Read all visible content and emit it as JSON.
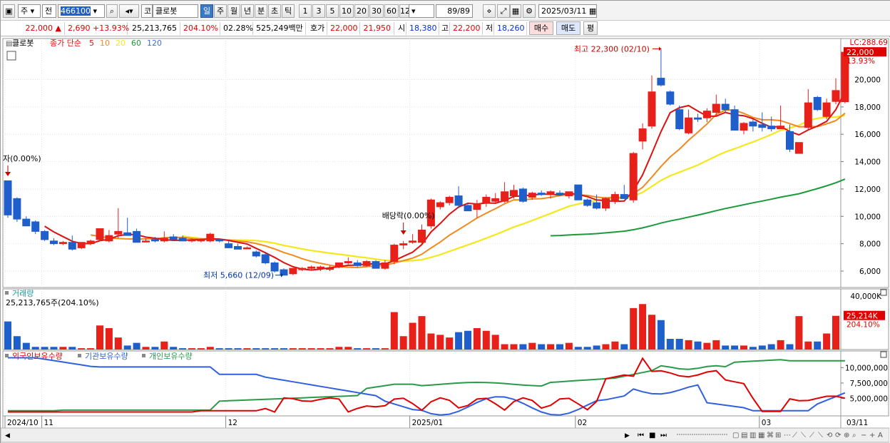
{
  "toolbar": {
    "chart_type": "주",
    "prev_label": "전",
    "code": "466100",
    "code_prefix": "코",
    "name": "클로봇",
    "periods": [
      "일",
      "주",
      "월",
      "년",
      "분",
      "초",
      "틱"
    ],
    "active_period": "일",
    "intervals": [
      "1",
      "3",
      "5",
      "10",
      "20",
      "30",
      "60",
      "120"
    ],
    "count": "89/89",
    "date": "2025/03/11"
  },
  "quote": {
    "price": "22,000",
    "up_arrow": "▲",
    "change": "2,690",
    "change_pct": "+13.93%",
    "volume": "25,213,765",
    "volume_ratio": "204.10%",
    "turnover": "02.28%",
    "amount": "525,249백만",
    "ask_label": "호가",
    "ask": "22,000",
    "bid": "21,950",
    "open_label": "시",
    "open": "18,380",
    "high_label": "고",
    "high": "22,200",
    "low_label": "저",
    "low": "18,260",
    "buy_label": "매수",
    "sell_label": "매도",
    "eval_label": "평"
  },
  "colors": {
    "up": "#e8201a",
    "down": "#1f5fcc",
    "ma5": "#dd1111",
    "ma10": "#f08a20",
    "ma20": "#f5e81a",
    "ma60": "#1a9a3a",
    "ma120": "#3a6fd8",
    "foreign": "#e00000",
    "institution": "#3060e0",
    "individual": "#2a9a4a"
  },
  "chart_data": {
    "type": "candlestick",
    "legend": {
      "name": "클로봇",
      "ma_label": "종가 단순",
      "periods": [
        "5",
        "10",
        "20",
        "60",
        "120"
      ]
    },
    "top_right_label": "LC:288.69",
    "price_axis": {
      "min": 4800,
      "max": 23000,
      "ticks": [
        6000,
        8000,
        10000,
        12000,
        14000,
        16000,
        18000,
        20000
      ],
      "tick_labels": [
        "6,000",
        "8,000",
        "10,000",
        "12,000",
        "14,000",
        "16,000",
        "18,000",
        "20,000"
      ]
    },
    "last_price_label": "22,000",
    "last_change_label": "13.93%",
    "annotations": {
      "high": "최고 22,300 (02/10)",
      "low": "최저 5,660 (12/09)",
      "listing": "자(0.00%)",
      "ex_dividend": "배당락(0.00%)"
    },
    "candles": [
      {
        "o": 12600,
        "h": 12600,
        "l": 9900,
        "c": 10100
      },
      {
        "o": 11300,
        "h": 11400,
        "l": 9600,
        "c": 9800
      },
      {
        "o": 9800,
        "h": 10000,
        "l": 9400,
        "c": 9300
      },
      {
        "o": 9600,
        "h": 9700,
        "l": 8700,
        "c": 8900
      },
      {
        "o": 8900,
        "h": 9000,
        "l": 8200,
        "c": 8300
      },
      {
        "o": 8200,
        "h": 8400,
        "l": 7900,
        "c": 8000
      },
      {
        "o": 8000,
        "h": 8200,
        "l": 7900,
        "c": 8100
      },
      {
        "o": 8100,
        "h": 8600,
        "l": 7500,
        "c": 7600
      },
      {
        "o": 7700,
        "h": 8100,
        "l": 7600,
        "c": 8100
      },
      {
        "o": 8000,
        "h": 8300,
        "l": 7900,
        "c": 8200
      },
      {
        "o": 8300,
        "h": 9000,
        "l": 8200,
        "c": 9100
      },
      {
        "o": 8200,
        "h": 9000,
        "l": 8100,
        "c": 8600
      },
      {
        "o": 8700,
        "h": 10600,
        "l": 8400,
        "c": 8900
      },
      {
        "o": 8800,
        "h": 9900,
        "l": 8700,
        "c": 8600
      },
      {
        "o": 8900,
        "h": 9100,
        "l": 8100,
        "c": 8100
      },
      {
        "o": 8200,
        "h": 8400,
        "l": 8100,
        "c": 8200
      },
      {
        "o": 8300,
        "h": 8500,
        "l": 8100,
        "c": 8200
      },
      {
        "o": 8200,
        "h": 8900,
        "l": 8100,
        "c": 8400
      },
      {
        "o": 8500,
        "h": 8700,
        "l": 8300,
        "c": 8300
      },
      {
        "o": 8400,
        "h": 8600,
        "l": 8200,
        "c": 8200
      },
      {
        "o": 8200,
        "h": 8400,
        "l": 8100,
        "c": 8300
      },
      {
        "o": 8200,
        "h": 8400,
        "l": 8100,
        "c": 8300
      },
      {
        "o": 8200,
        "h": 8800,
        "l": 8100,
        "c": 8700
      },
      {
        "o": 8300,
        "h": 8400,
        "l": 8100,
        "c": 8200
      },
      {
        "o": 8000,
        "h": 8200,
        "l": 7700,
        "c": 7700
      },
      {
        "o": 7800,
        "h": 8000,
        "l": 7600,
        "c": 7600
      },
      {
        "o": 7700,
        "h": 7800,
        "l": 7600,
        "c": 7700
      },
      {
        "o": 7400,
        "h": 7500,
        "l": 7000,
        "c": 7100
      },
      {
        "o": 7200,
        "h": 7400,
        "l": 6500,
        "c": 6600
      },
      {
        "o": 6600,
        "h": 6700,
        "l": 5900,
        "c": 6000
      },
      {
        "o": 6100,
        "h": 6200,
        "l": 5700,
        "c": 5700
      },
      {
        "o": 5800,
        "h": 6200,
        "l": 5700,
        "c": 6200
      },
      {
        "o": 6100,
        "h": 6300,
        "l": 6000,
        "c": 6200
      },
      {
        "o": 6200,
        "h": 6400,
        "l": 6100,
        "c": 6300
      },
      {
        "o": 6200,
        "h": 6400,
        "l": 6000,
        "c": 6300
      },
      {
        "o": 6200,
        "h": 6400,
        "l": 6000,
        "c": 6200
      },
      {
        "o": 6300,
        "h": 6600,
        "l": 6200,
        "c": 6600
      },
      {
        "o": 6600,
        "h": 7000,
        "l": 6500,
        "c": 6700
      },
      {
        "o": 6600,
        "h": 6800,
        "l": 6300,
        "c": 6400
      },
      {
        "o": 6400,
        "h": 6800,
        "l": 6300,
        "c": 6700
      },
      {
        "o": 6700,
        "h": 6800,
        "l": 6300,
        "c": 6200
      },
      {
        "o": 6200,
        "h": 6800,
        "l": 6100,
        "c": 6600
      },
      {
        "o": 6700,
        "h": 8000,
        "l": 6500,
        "c": 7900
      },
      {
        "o": 7900,
        "h": 8200,
        "l": 7600,
        "c": 8000
      },
      {
        "o": 8100,
        "h": 8700,
        "l": 8000,
        "c": 8200
      },
      {
        "o": 8100,
        "h": 9400,
        "l": 8000,
        "c": 9000
      },
      {
        "o": 9300,
        "h": 11300,
        "l": 9100,
        "c": 11200
      },
      {
        "o": 10700,
        "h": 11100,
        "l": 10500,
        "c": 11000
      },
      {
        "o": 11000,
        "h": 11500,
        "l": 10800,
        "c": 11400
      },
      {
        "o": 11500,
        "h": 12200,
        "l": 10600,
        "c": 10800
      },
      {
        "o": 10800,
        "h": 11000,
        "l": 10400,
        "c": 10400
      },
      {
        "o": 10500,
        "h": 11200,
        "l": 9900,
        "c": 10900
      },
      {
        "o": 11000,
        "h": 11600,
        "l": 10700,
        "c": 11400
      },
      {
        "o": 11100,
        "h": 11700,
        "l": 10900,
        "c": 11300
      },
      {
        "o": 11100,
        "h": 12500,
        "l": 11000,
        "c": 11800
      },
      {
        "o": 11500,
        "h": 12300,
        "l": 11300,
        "c": 11900
      },
      {
        "o": 12000,
        "h": 12100,
        "l": 11000,
        "c": 11100
      },
      {
        "o": 11400,
        "h": 11800,
        "l": 11200,
        "c": 11700
      },
      {
        "o": 11700,
        "h": 11900,
        "l": 11500,
        "c": 11600
      },
      {
        "o": 11600,
        "h": 11900,
        "l": 11300,
        "c": 11800
      },
      {
        "o": 11700,
        "h": 11900,
        "l": 11500,
        "c": 11600
      },
      {
        "o": 11500,
        "h": 11800,
        "l": 11300,
        "c": 11800
      },
      {
        "o": 12300,
        "h": 12300,
        "l": 11200,
        "c": 11200
      },
      {
        "o": 11200,
        "h": 11300,
        "l": 10700,
        "c": 10800
      },
      {
        "o": 11000,
        "h": 11600,
        "l": 10500,
        "c": 10600
      },
      {
        "o": 10600,
        "h": 11400,
        "l": 10400,
        "c": 11300
      },
      {
        "o": 11100,
        "h": 11800,
        "l": 10900,
        "c": 11600
      },
      {
        "o": 11600,
        "h": 12300,
        "l": 11300,
        "c": 11300
      },
      {
        "o": 11200,
        "h": 14700,
        "l": 11000,
        "c": 14600
      },
      {
        "o": 15500,
        "h": 16800,
        "l": 14900,
        "c": 16400
      },
      {
        "o": 16600,
        "h": 20300,
        "l": 16400,
        "c": 19100
      },
      {
        "o": 20100,
        "h": 22300,
        "l": 19500,
        "c": 19600
      },
      {
        "o": 19100,
        "h": 19200,
        "l": 18100,
        "c": 18200
      },
      {
        "o": 17800,
        "h": 18100,
        "l": 16300,
        "c": 16400
      },
      {
        "o": 16100,
        "h": 17800,
        "l": 16000,
        "c": 17200
      },
      {
        "o": 17200,
        "h": 17500,
        "l": 16900,
        "c": 17100
      },
      {
        "o": 17200,
        "h": 17900,
        "l": 16900,
        "c": 17700
      },
      {
        "o": 17600,
        "h": 18900,
        "l": 17300,
        "c": 18200
      },
      {
        "o": 18200,
        "h": 18600,
        "l": 17600,
        "c": 17800
      },
      {
        "o": 17800,
        "h": 18100,
        "l": 16400,
        "c": 16300
      },
      {
        "o": 16300,
        "h": 16900,
        "l": 16000,
        "c": 16800
      },
      {
        "o": 16900,
        "h": 17100,
        "l": 16200,
        "c": 16600
      },
      {
        "o": 16700,
        "h": 17600,
        "l": 16200,
        "c": 16500
      },
      {
        "o": 16600,
        "h": 17300,
        "l": 16200,
        "c": 16400
      },
      {
        "o": 16400,
        "h": 18100,
        "l": 16400,
        "c": 16600
      },
      {
        "o": 16200,
        "h": 16700,
        "l": 14700,
        "c": 14900
      },
      {
        "o": 14600,
        "h": 15400,
        "l": 14600,
        "c": 15400
      },
      {
        "o": 16500,
        "h": 19300,
        "l": 16300,
        "c": 18300
      },
      {
        "o": 18700,
        "h": 18800,
        "l": 17700,
        "c": 17800
      },
      {
        "o": 17300,
        "h": 18600,
        "l": 17100,
        "c": 18300
      },
      {
        "o": 18400,
        "h": 20100,
        "l": 18200,
        "c": 19200
      },
      {
        "o": 18380,
        "h": 22200,
        "l": 18260,
        "c": 22000
      }
    ],
    "volume_panel": {
      "title": "거래량",
      "current": "25,213,765주(204.10%)",
      "max": 40000,
      "top_label": "40,000K",
      "last_label": "25,214K",
      "last_pct": "204.10%",
      "values": [
        21000,
        10000,
        5000,
        2000,
        2000,
        2000,
        2000,
        2000,
        1000,
        1000,
        18000,
        16000,
        9000,
        3000,
        5000,
        2000,
        2000,
        6000,
        2000,
        1000,
        1000,
        1000,
        2000,
        1000,
        1000,
        1000,
        1000,
        1000,
        1000,
        1000,
        1000,
        1000,
        1000,
        1000,
        1000,
        1000,
        2000,
        2000,
        1000,
        1000,
        1000,
        1000,
        28000,
        10000,
        20000,
        25000,
        12000,
        11000,
        9000,
        13000,
        14000,
        16000,
        14000,
        11000,
        4000,
        4000,
        4000,
        5000,
        4000,
        4000,
        4000,
        5000,
        2000,
        2000,
        3000,
        4000,
        6000,
        4000,
        31000,
        34000,
        26000,
        22000,
        8000,
        8000,
        7000,
        6000,
        5000,
        7000,
        3000,
        3000,
        3000,
        2000,
        3000,
        4000,
        7000,
        4000,
        25000,
        6000,
        6000,
        12000,
        25214
      ]
    },
    "holdings_panel": {
      "series_names": [
        "외국인보유수량",
        "기관보유수량",
        "개인보유수량"
      ],
      "ticks": [
        "10,000,000",
        "7,500,000",
        "5,000,000"
      ],
      "tick_values": [
        10000000,
        7500000,
        5000000
      ],
      "min": 2400000,
      "max": 12000000
    },
    "x_labels": [
      {
        "text": "2024/10",
        "index": 0
      },
      {
        "text": "11",
        "index": 4
      },
      {
        "text": "12",
        "index": 24
      },
      {
        "text": "2025/01",
        "index": 44
      },
      {
        "text": "02",
        "index": 62
      },
      {
        "text": "03",
        "index": 82
      }
    ],
    "x_axis_right": "03/11"
  }
}
